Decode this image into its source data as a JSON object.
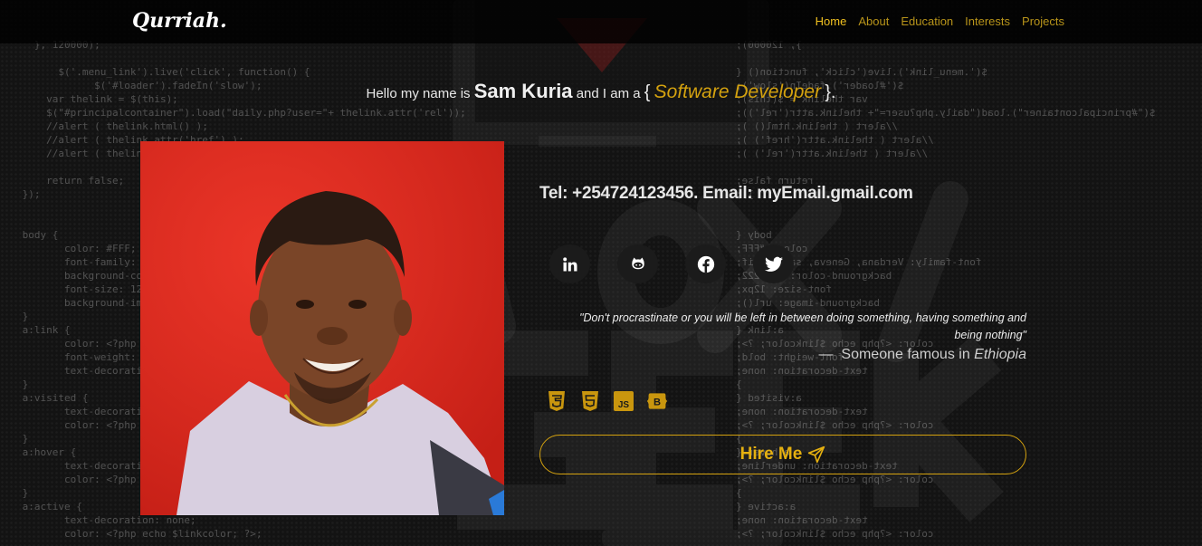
{
  "brand": "Qurriah.",
  "nav": [
    {
      "label": "Home",
      "active": true
    },
    {
      "label": "About"
    },
    {
      "label": "Education"
    },
    {
      "label": "Interests"
    },
    {
      "label": "Projects"
    }
  ],
  "intro": {
    "prefix": "Hello my name is",
    "name": "Sam Kuria",
    "middle": "and I am a",
    "open_brace": "{",
    "role": "Software Developer",
    "close_brace": "}."
  },
  "contact": "Tel: +254724123456. Email: myEmail.gmail.com",
  "socials": [
    {
      "icon": "linkedin-icon"
    },
    {
      "icon": "github-icon"
    },
    {
      "icon": "facebook-icon"
    },
    {
      "icon": "twitter-icon"
    }
  ],
  "quote": {
    "text": "\"Don't procrastinate or you will be left in between doing something, having something and being nothing\"",
    "dash": "—",
    "author": "Someone famous in",
    "place": "Ethiopia"
  },
  "techs": [
    "css3-icon",
    "html5-icon",
    "javascript-icon",
    "bootstrap-icon"
  ],
  "hire": {
    "label": "Hire Me"
  },
  "colors": {
    "accent": "#d4a20f",
    "photo_bg": "#e52a20"
  }
}
